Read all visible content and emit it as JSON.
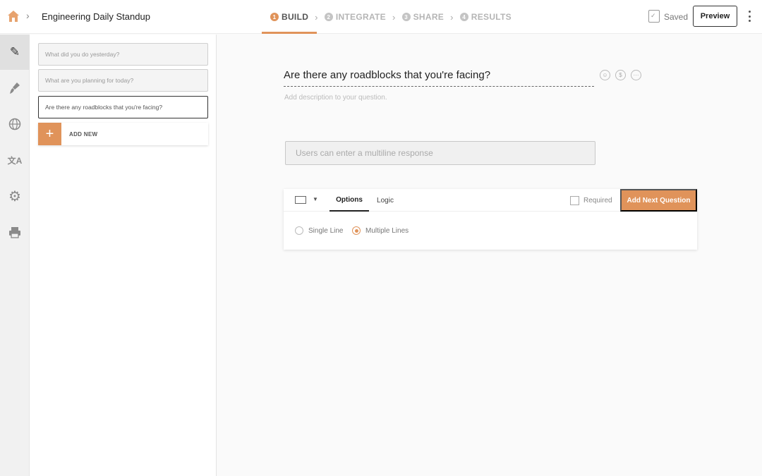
{
  "header": {
    "form_title": "Engineering Daily Standup",
    "steps": [
      {
        "num": "1",
        "label": "BUILD",
        "active": true
      },
      {
        "num": "2",
        "label": "INTEGRATE"
      },
      {
        "num": "3",
        "label": "SHARE"
      },
      {
        "num": "4",
        "label": "RESULTS"
      }
    ],
    "saved_label": "Saved",
    "preview_label": "Preview"
  },
  "rail": {
    "items": [
      "pencil-icon",
      "brush-icon",
      "globe-icon",
      "translate-icon",
      "gear-icon",
      "printer-icon"
    ],
    "glyphs": [
      "✎",
      "🖌",
      "◍",
      "文A",
      "⚙",
      "⎙"
    ]
  },
  "questions": {
    "items": [
      "What did you do yesterday?",
      "What are you planning for today?",
      "Are there any roadblocks that you're facing?"
    ],
    "selected_index": 2,
    "add_new_label": "ADD NEW"
  },
  "editor": {
    "question_title": "Are there any roadblocks that you're facing?",
    "description_placeholder": "Add description to your question.",
    "response_placeholder": "Users can enter a multiline response",
    "actions": [
      "☺",
      "$",
      "···"
    ],
    "tabs": {
      "options": "Options",
      "logic": "Logic"
    },
    "required_label": "Required",
    "next_button": "Add Next Question",
    "line_options": {
      "single": "Single Line",
      "multiple": "Multiple Lines",
      "selected": "multiple"
    }
  },
  "colors": {
    "accent": "#e0935a"
  }
}
